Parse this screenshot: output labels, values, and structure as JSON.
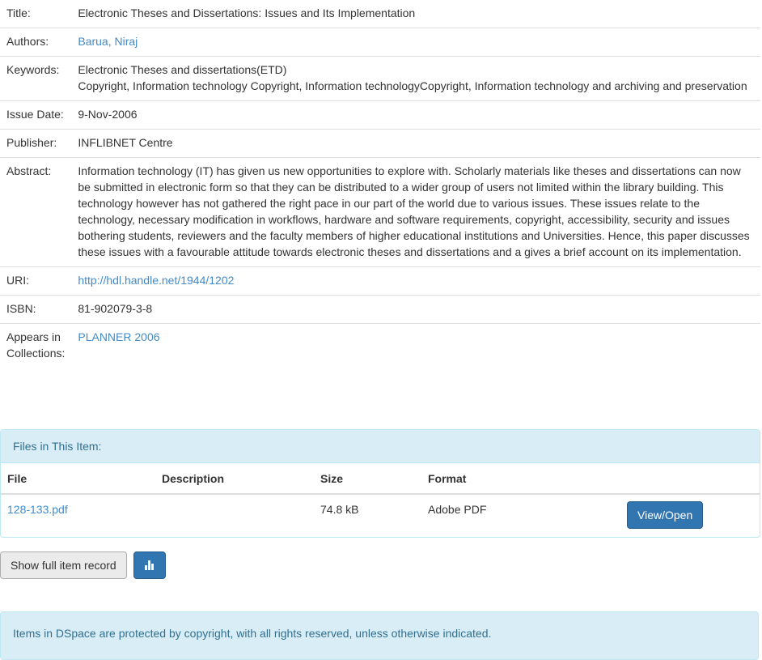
{
  "metadata": {
    "title": {
      "label": "Title:",
      "value": "Electronic Theses and Dissertations: Issues and Its Implementation"
    },
    "authors": {
      "label": "Authors:",
      "value": "Barua, Niraj"
    },
    "keywords": {
      "label": "Keywords:",
      "lines": [
        "Electronic Theses and dissertations(ETD)",
        "Copyright, Information technology Copyright, Information technologyCopyright, Information technology and archiving and preservation"
      ]
    },
    "issue_date": {
      "label": "Issue Date:",
      "value": "9-Nov-2006"
    },
    "publisher": {
      "label": "Publisher:",
      "value": "INFLIBNET Centre"
    },
    "abstract": {
      "label": "Abstract:",
      "value": "Information technology (IT) has given us new opportunities to explore with. Scholarly materials like theses and dissertations can now be submitted in electronic form so that they can be distributed to a wider group of users not limited within the library building. This technology however has not gathered the right pace in our part of the world due to various issues. These issues relate to the technology, necessary modification in workflows, hardware and software requirements, copyright, accessibility, security and issues bothering students, reviewers and the faculty members of higher educational institutions and Universities. Hence, this paper discusses these issues with a favourable attitude towards electronic theses and dissertations and a gives a brief account on its implementation."
    },
    "uri": {
      "label": "URI:",
      "value": "http://hdl.handle.net/1944/1202"
    },
    "isbn": {
      "label": "ISBN:",
      "value": "81-902079-3-8"
    },
    "collections": {
      "label": "Appears in Collections:",
      "value": "PLANNER 2006"
    }
  },
  "files": {
    "heading": "Files in This Item:",
    "columns": [
      "File",
      "Description",
      "Size",
      "Format"
    ],
    "rows": [
      {
        "file": "128-133.pdf",
        "description": "",
        "size": "74.8 kB",
        "format": "Adobe PDF",
        "action": "View/Open"
      }
    ]
  },
  "actions": {
    "full_record": "Show full item record",
    "stats_icon": "bar-chart-icon"
  },
  "footer": {
    "copyright": "Items in DSpace are protected by copyright, with all rights reserved, unless otherwise indicated."
  },
  "colors": {
    "link": "#428bca",
    "primary": "#3276b1",
    "info_bg": "#d9edf7",
    "info_text": "#31708f"
  }
}
